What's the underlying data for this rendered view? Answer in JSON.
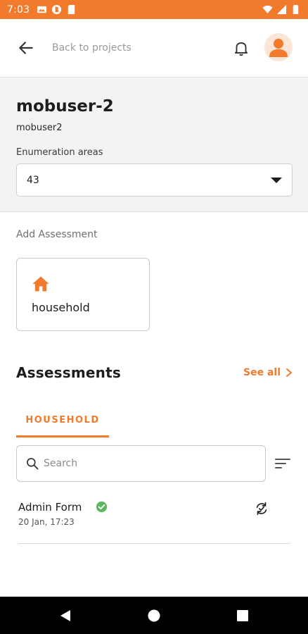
{
  "status_bar": {
    "time": "7:03",
    "background_color": "#f27a2c",
    "icons_left": [
      "gallery-icon",
      "circle-b-icon",
      "sd-card-icon"
    ],
    "icons_right": [
      "wifi-icon",
      "signal-icon",
      "battery-icon"
    ]
  },
  "header": {
    "back_label": "Back to projects",
    "icons": [
      "back-arrow-icon",
      "bell-icon",
      "user-avatar-icon"
    ]
  },
  "user": {
    "name": "mobuser-2",
    "username": "mobuser2"
  },
  "enumeration": {
    "label": "Enumeration areas",
    "selected": "43"
  },
  "add_assessment": {
    "label": "Add Assessment",
    "cards": [
      {
        "label": "household",
        "icon": "home-icon"
      }
    ]
  },
  "assessments": {
    "title": "Assessments",
    "see_all": "See all",
    "tabs": [
      {
        "label": "HOUSEHOLD",
        "active": true
      }
    ],
    "search_placeholder": "Search",
    "items": [
      {
        "title": "Admin Form",
        "date": "20 Jan, 17:23",
        "status": "completed"
      }
    ]
  },
  "theme": {
    "accent": "#f27a2c",
    "success": "#5cb85c"
  }
}
